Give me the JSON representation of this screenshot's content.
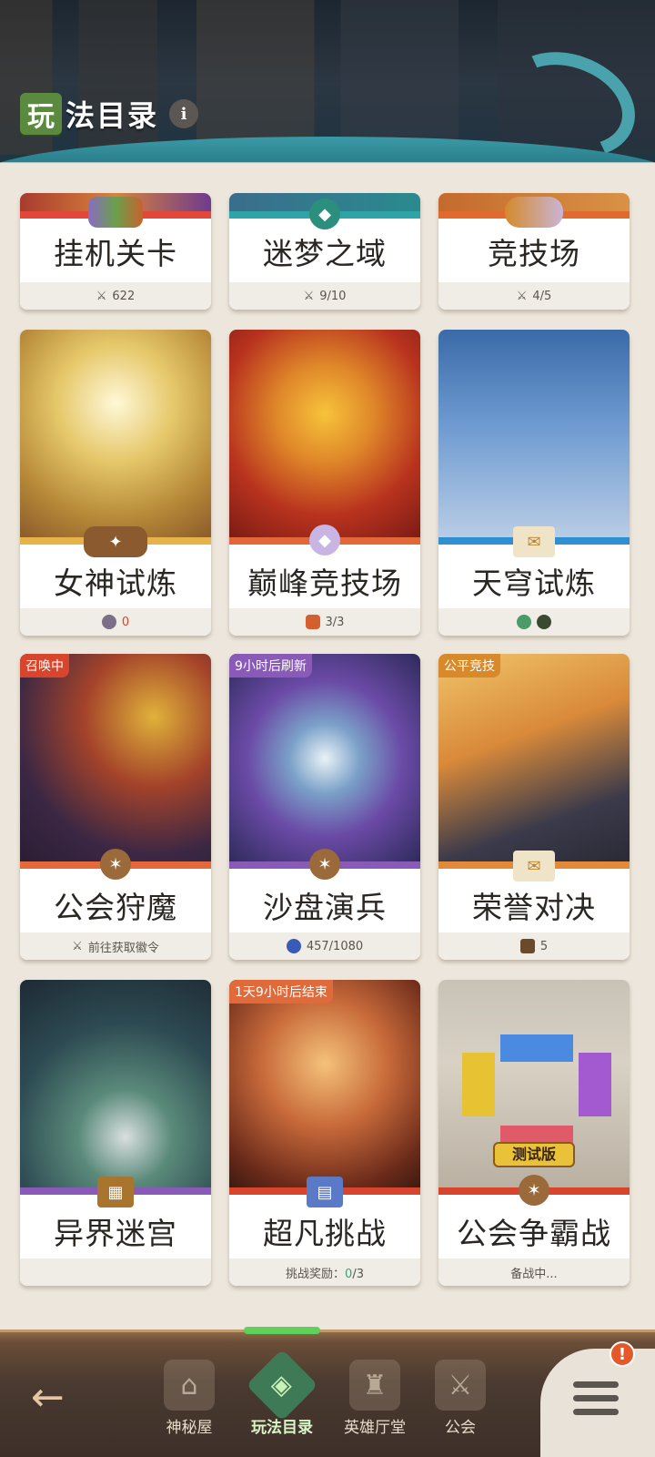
{
  "header": {
    "title_first": "玩",
    "title_rest": "法目录",
    "info_icon": "i"
  },
  "cards": [
    {
      "name": "挂机关卡",
      "footer": "622",
      "footer_icon": "swords-icon"
    },
    {
      "name": "迷梦之域",
      "footer": "9/10",
      "footer_icon": "swords-icon"
    },
    {
      "name": "竞技场",
      "footer": "4/5",
      "footer_icon": "swords-icon"
    },
    {
      "name": "女神试炼",
      "footer": "0",
      "footer_icon": "coin-icon"
    },
    {
      "name": "巅峰竞技场",
      "footer": "3/3",
      "footer_icon": "shield-badge-icon"
    },
    {
      "name": "天穹试炼",
      "footer": "",
      "footer_icon": "gem-icons"
    },
    {
      "name": "公会狩魔",
      "footer": "前往获取徽令",
      "footer_icon": "swords-icon",
      "tag": "召唤中"
    },
    {
      "name": "沙盘演兵",
      "footer": "457/1080",
      "footer_icon": "key-icon",
      "tag": "9小时后刷新"
    },
    {
      "name": "荣誉对决",
      "footer": "5",
      "footer_icon": "treasure-icon",
      "tag": "公平竞技"
    },
    {
      "name": "异界迷宫",
      "footer": "",
      "footer_icon": ""
    },
    {
      "name": "超凡挑战",
      "footer_prefix": "挑战奖励：",
      "footer_value": "0",
      "footer_suffix": "/3",
      "tag": "1天9小时后结束"
    },
    {
      "name": "公会争霸战",
      "footer": "备战中...",
      "ribbon": "测试版"
    }
  ],
  "nav": {
    "back": "←",
    "items": [
      {
        "label": "神秘屋"
      },
      {
        "label": "玩法目录"
      },
      {
        "label": "英雄厅堂"
      },
      {
        "label": "公会"
      }
    ],
    "alert": "!"
  },
  "colors": {
    "accent_green": "#3d7a55",
    "nav_bg": "#3d3029",
    "alert": "#e5582a",
    "count_green": "#3aa56a",
    "count_red": "#d8452c"
  }
}
